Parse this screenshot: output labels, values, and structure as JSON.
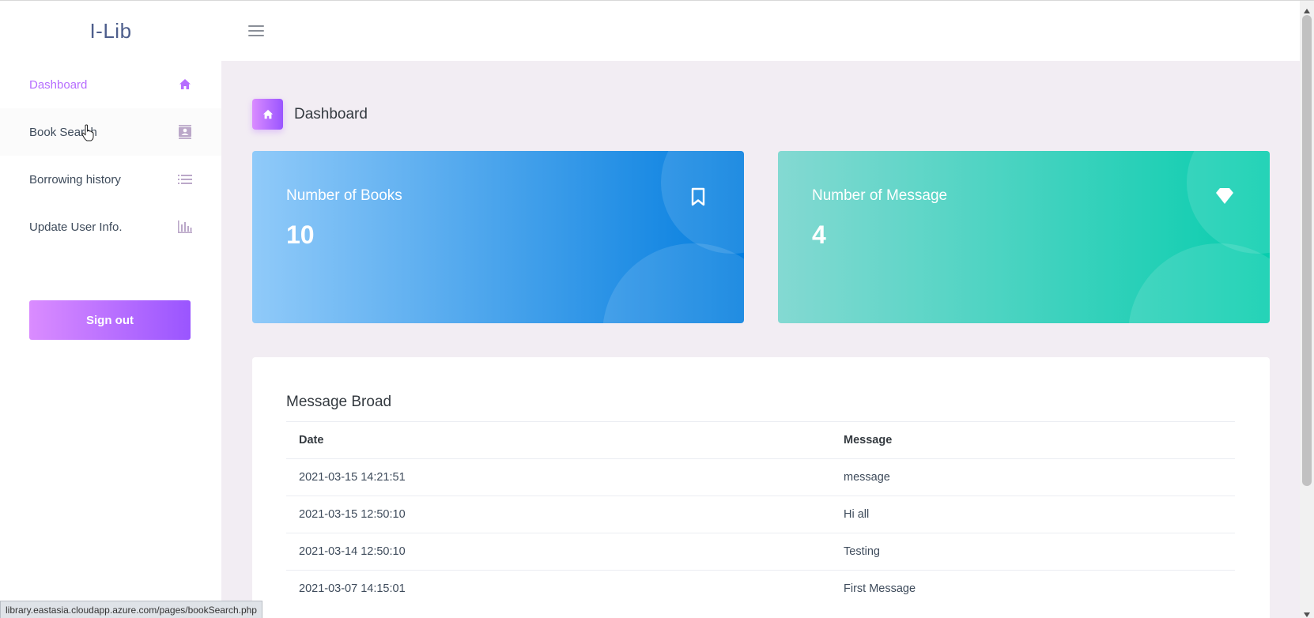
{
  "app": {
    "brand": "I-Lib"
  },
  "sidebar": {
    "items": [
      {
        "label": "Dashboard",
        "icon": "home-icon",
        "active": true
      },
      {
        "label": "Book Search",
        "icon": "contacts-icon",
        "active": false
      },
      {
        "label": "Borrowing history",
        "icon": "list-icon",
        "active": false
      },
      {
        "label": "Update User Info.",
        "icon": "bar-chart-icon",
        "active": false
      }
    ],
    "signout_label": "Sign out"
  },
  "page": {
    "title": "Dashboard",
    "icon": "home-icon"
  },
  "stats": [
    {
      "label": "Number of Books",
      "value": "10",
      "icon": "bookmark-icon",
      "color": "#047edf"
    },
    {
      "label": "Number of Message",
      "value": "4",
      "icon": "diamond-icon",
      "color": "#07cdae"
    }
  ],
  "message_board": {
    "title": "Message Broad",
    "columns": [
      "Date",
      "Message"
    ],
    "rows": [
      [
        "2021-03-15 14:21:51",
        "message"
      ],
      [
        "2021-03-15 12:50:10",
        "Hi all"
      ],
      [
        "2021-03-14 12:50:10",
        "Testing"
      ],
      [
        "2021-03-07 14:15:01",
        "First Message"
      ]
    ]
  },
  "status_bar": {
    "url": "library.eastasia.cloudapp.azure.com/pages/bookSearch.php"
  },
  "colors": {
    "accent": "#b66dff",
    "page_bg": "#f2edf3"
  }
}
